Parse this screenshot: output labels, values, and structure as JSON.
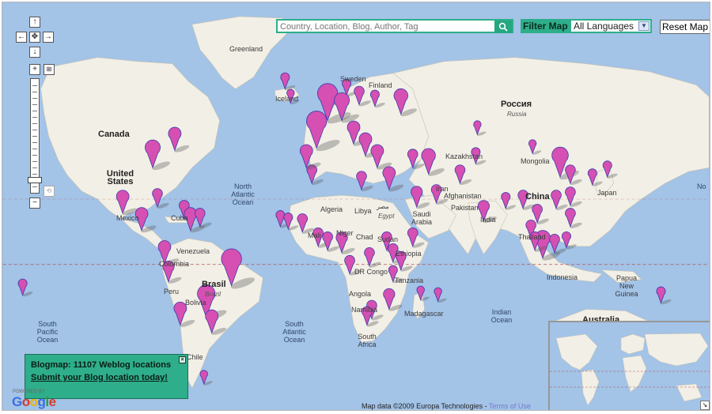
{
  "search": {
    "placeholder": "Country, Location, Blog, Author, Tag"
  },
  "filter": {
    "label": "Filter Map",
    "selected_language": "All Languages"
  },
  "reset_label": "Reset Map",
  "info_box": {
    "title": "Blogmap: 11107 Weblog locations",
    "link": "Submit your Blog location today!"
  },
  "attribution": {
    "text": "Map data ©2009 Europa Technologies -",
    "terms": "Terms of Use"
  },
  "branding": {
    "powered": "POWERED BY",
    "logo": "Google"
  },
  "labels": {
    "greenland": "Greenland",
    "iceland": "Iceland",
    "sweden": "Sweden",
    "finland": "Finland",
    "canada": "Canada",
    "united_states": "United States",
    "mexico": "Mexico",
    "cuba": "Cuba",
    "venezuela": "Venezuela",
    "colombia": "Colombia",
    "peru": "Peru",
    "bolivia": "Bolivia",
    "brazil": "Brasil",
    "brazil_sub": "Brazil",
    "chile": "Chile",
    "algeria": "Algeria",
    "libya": "Libya",
    "egypt": "Egypt",
    "egypt_sub": "مصر",
    "mali": "Mali",
    "niger": "Niger",
    "chad": "Chad",
    "sudan": "Sudan",
    "ethiopia": "Ethiopia",
    "dr_congo": "DR Congo",
    "tanzania": "Tanzania",
    "angola": "Angola",
    "namibia": "Namibia",
    "south_africa": "South Africa",
    "madagascar": "Madagascar",
    "saudi": "Saudi Arabia",
    "iran": "Iran",
    "afghanistan": "Afghanistan",
    "pakistan": "Pakistan",
    "india": "India",
    "kazakhstan": "Kazakhstan",
    "mongolia": "Mongolia",
    "china": "China",
    "japan": "Japan",
    "russia": "Россия",
    "russia_sub": "Russia",
    "thailand": "Thailand",
    "indonesia": "Indonesia",
    "png": "Papua New Guinea",
    "australia": "Australia",
    "north_atlantic": "North Atlantic Ocean",
    "south_pacific": "South Pacific Ocean",
    "south_atlantic": "South Atlantic Ocean",
    "indian_ocean": "Indian Ocean",
    "north_pacific_r": "No"
  },
  "colors": {
    "marker": "#d64fb2",
    "marker_outline": "#3c3caa",
    "panel": "#2eae8a",
    "land": "#f2efe6",
    "water": "#a3c3e7"
  },
  "markers_note_icon": "map-pin-icon",
  "nav_icons": [
    "arrow-up-icon",
    "arrow-left-icon",
    "center-icon",
    "arrow-right-icon",
    "arrow-down-icon",
    "zoom-in-icon",
    "zoom-out-icon"
  ]
}
